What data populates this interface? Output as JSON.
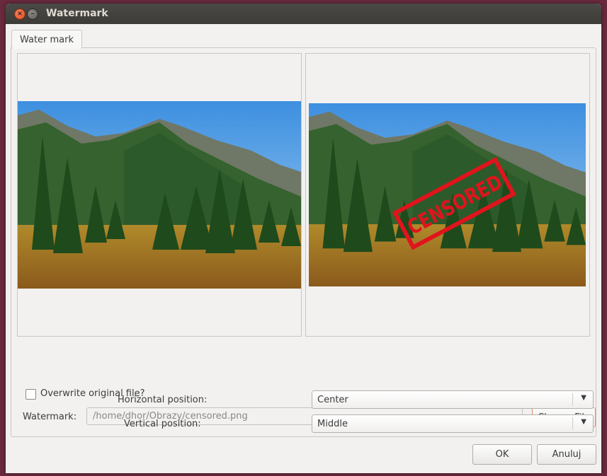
{
  "window": {
    "title": "Watermark"
  },
  "tabs": [
    {
      "label": "Water mark"
    }
  ],
  "overwrite": {
    "label": "Overwrite original file?",
    "checked": false
  },
  "watermark": {
    "label": "Watermark:",
    "path": "/home/dhor/Obrazy/censored.png",
    "choose_label": "Choose File"
  },
  "horizontal": {
    "label": "Horizontal position:",
    "value": "Center"
  },
  "vertical": {
    "label": "Vertical position:",
    "value": "Middle"
  },
  "buttons": {
    "ok": "OK",
    "cancel": "Anuluj"
  },
  "stamp": {
    "text": "CENSORED",
    "color": "#e0141c"
  },
  "colors": {
    "titlebar": "#3c3b37",
    "window_bg": "#f2f1f0",
    "accent": "#e8886a"
  }
}
